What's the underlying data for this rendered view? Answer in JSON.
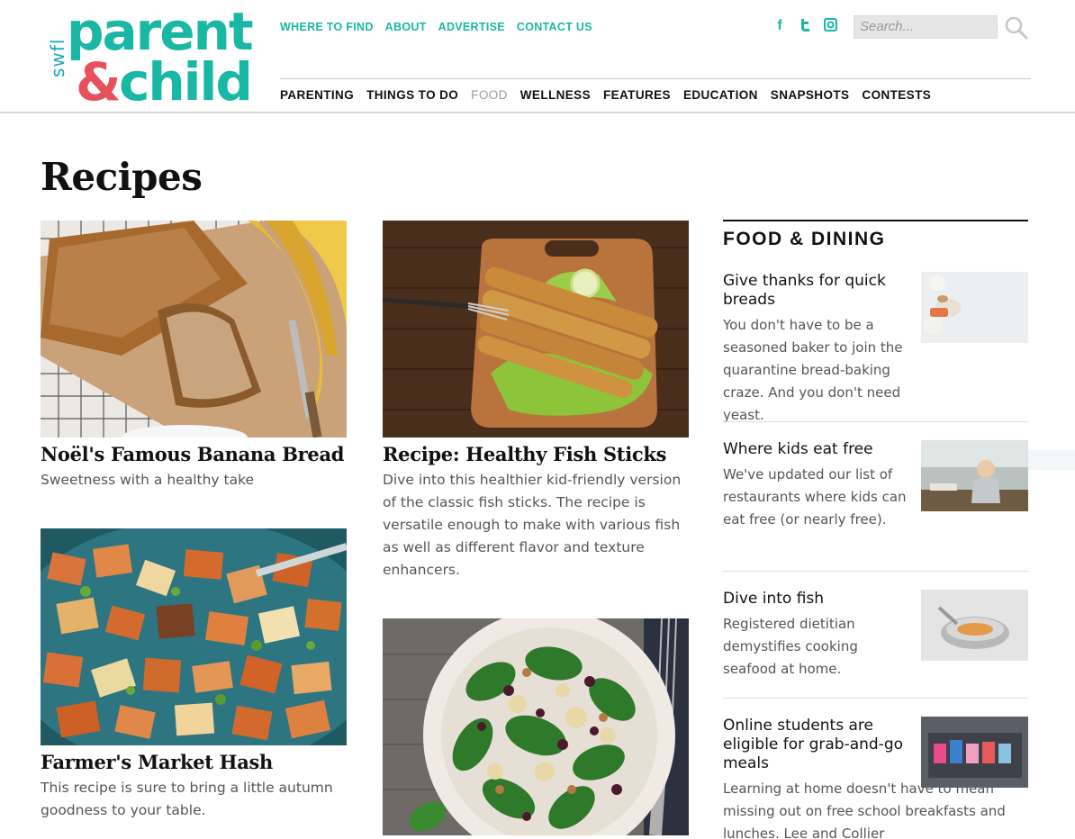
{
  "brand": {
    "prefix": "swfl",
    "word1": "parent",
    "amp": "&",
    "word2": "child"
  },
  "top_nav": [
    "WHERE TO FIND",
    "ABOUT",
    "ADVERTISE",
    "CONTACT US"
  ],
  "social": {
    "facebook": "f",
    "twitter": "t",
    "instagram": "◻"
  },
  "search": {
    "placeholder": "Search..."
  },
  "main_nav": [
    {
      "label": "PARENTING",
      "active": false
    },
    {
      "label": "THINGS TO DO",
      "active": false
    },
    {
      "label": "FOOD",
      "active": true
    },
    {
      "label": "WELLNESS",
      "active": false
    },
    {
      "label": "FEATURES",
      "active": false
    },
    {
      "label": "EDUCATION",
      "active": false
    },
    {
      "label": "SNAPSHOTS",
      "active": false
    },
    {
      "label": "CONTESTS",
      "active": false
    }
  ],
  "page": {
    "title": "Recipes"
  },
  "recipes": [
    {
      "title": "Noël's Famous Banana Bread",
      "desc": "Sweetness with a healthy take"
    },
    {
      "title": "Recipe: Healthy Fish Sticks",
      "desc": "Dive into this healthier kid-friendly version of the classic fish sticks. The recipe is versatile enough to make with various fish as well as different flavor and texture enhancers."
    },
    {
      "title": "Farmer's Market Hash",
      "desc": "This recipe is sure to bring a little autumn goodness to your table."
    }
  ],
  "sidebar": {
    "heading": "FOOD & DINING",
    "items": [
      {
        "title": "Give thanks for quick breads",
        "desc": "You don't have to be a seasoned baker to join the quarantine bread-baking craze. And you don't need yeast."
      },
      {
        "title": "Where kids eat free",
        "desc": "We've updated our list of restaurants where kids can eat free (or nearly free)."
      },
      {
        "title": "Dive into fish",
        "desc": "Registered dietitian demystifies cooking seafood at home."
      },
      {
        "title": "Online students are eligible for grab-and-go meals",
        "desc": "Learning at home doesn't have to mean missing out on free school breakfasts and lunches. Lee and Collier"
      }
    ]
  }
}
